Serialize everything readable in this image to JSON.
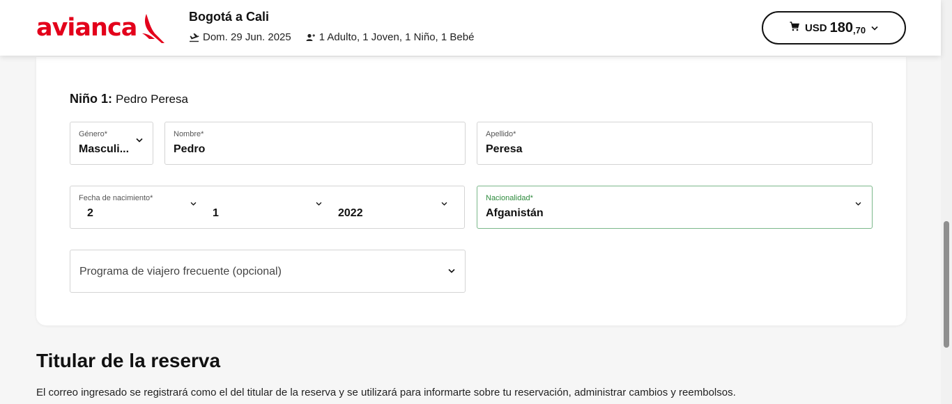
{
  "header": {
    "logo_text": "avianca",
    "route": "Bogotá a Cali",
    "date": "Dom. 29 Jun. 2025",
    "passengers": "1 Adulto, 1 Joven, 1 Niño, 1 Bebé",
    "cart": {
      "currency": "USD",
      "amount": "180",
      "cents": ",70"
    },
    "brand_color": "#e3001b"
  },
  "passenger_form": {
    "heading_label": "Niño 1:",
    "heading_name": "Pedro Peresa",
    "gender": {
      "label": "Género*",
      "value": "Masculi..."
    },
    "first_name": {
      "label": "Nombre*",
      "value": "Pedro"
    },
    "last_name": {
      "label": "Apellido*",
      "value": "Peresa"
    },
    "birth_date": {
      "label": "Fecha de nacimiento*",
      "day": "2",
      "month": "1",
      "year": "2022"
    },
    "nationality": {
      "label": "Nacionalidad*",
      "value": "Afganistán"
    },
    "frequent_flyer": {
      "placeholder": "Programa de viajero frecuente (opcional)"
    }
  },
  "booking_holder": {
    "title": "Titular de la reserva",
    "description": "El correo ingresado se registrará como el del titular de la reserva y se utilizará para informarte sobre tu reservación, administrar cambios y reembolsos."
  }
}
